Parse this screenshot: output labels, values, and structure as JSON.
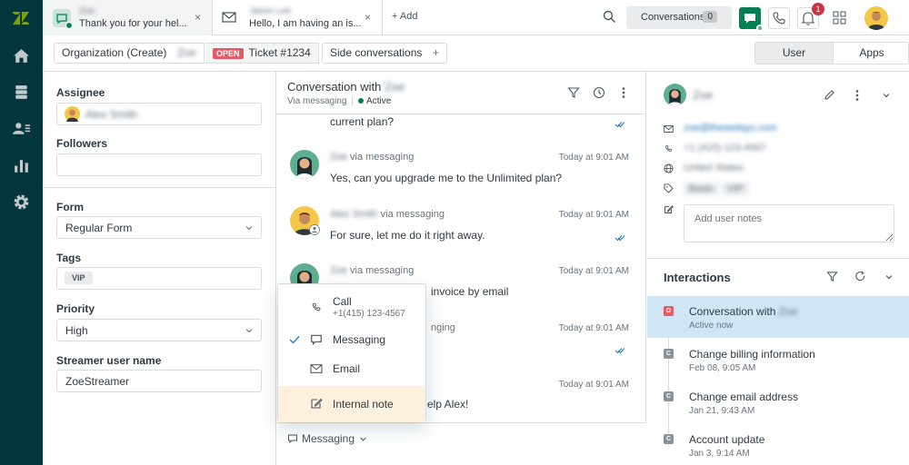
{
  "top_tabs": [
    {
      "name": "Zoe",
      "preview": "Thank you for your hel...",
      "close": "×"
    },
    {
      "name": "Jason Lee",
      "preview": "Hello, I am having an is...",
      "close": "×"
    }
  ],
  "add_tab": "+ Add",
  "conversations": {
    "label": "Conversations",
    "count": "0"
  },
  "notifications_count": "1",
  "breadcrumbs": {
    "org": "Organization (Create)",
    "user": "Zoe",
    "status": "OPEN",
    "ticket": "Ticket #1234",
    "side": "Side conversations",
    "plus": "+"
  },
  "context_tabs": {
    "user": "User",
    "apps": "Apps"
  },
  "props": {
    "assignee_label": "Assignee",
    "assignee_value": "Alex Smith",
    "followers_label": "Followers",
    "form_label": "Form",
    "form_value": "Regular Form",
    "tags_label": "Tags",
    "tag_value": "VIP",
    "priority_label": "Priority",
    "priority_value": "High",
    "streamer_label": "Streamer user name",
    "streamer_value": "ZoeStreamer"
  },
  "conversation": {
    "title": "Conversation with",
    "title_name": "Zoe",
    "via": "Via messaging",
    "status": "Active",
    "partial_text": "current plan?",
    "messages": [
      {
        "sender": "Zoe",
        "via": "via messaging",
        "time": "Today at 9:01 AM",
        "text": "Yes, can you upgrade me to the Unlimited plan?"
      },
      {
        "sender": "Alex Smith",
        "via": "via messaging",
        "time": "Today at 9:01 AM",
        "text": "For sure, let me do it right away."
      },
      {
        "sender": "Zoe",
        "via": "via messaging",
        "time": "Today at 9:01 AM",
        "text": "invoice by email"
      },
      {
        "sender": "",
        "via": "nging",
        "time": "Today at 9:01 AM",
        "text": ""
      },
      {
        "sender": "",
        "via": "",
        "time": "Today at 9:01 AM",
        "text": "elp Alex!"
      }
    ],
    "composer_channel": "Messaging"
  },
  "channel_menu": {
    "call_label": "Call",
    "call_number": "+1(415) 123-4567",
    "messaging_label": "Messaging",
    "email_label": "Email",
    "note_label": "Internal note"
  },
  "user_panel": {
    "name": "Zoe",
    "email": "zoe@thesedays.com",
    "phone": "+1 (415) 123-4567",
    "location": "United States",
    "tags": [
      "Basic",
      "VIP"
    ],
    "notes_placeholder": "Add user notes"
  },
  "interactions": {
    "title": "Interactions",
    "items": [
      {
        "badge": "O",
        "title": "Conversation with",
        "name": "Zoe",
        "sub": "Active now"
      },
      {
        "badge": "C",
        "title": "Change billing information",
        "sub": "Feb 08, 9:05 AM"
      },
      {
        "badge": "C",
        "title": "Change email address",
        "sub": "Jan 21, 9:43 AM"
      },
      {
        "badge": "C",
        "title": "Account update",
        "sub": "Jan 3, 9:14 AM"
      }
    ]
  },
  "colors": {
    "nav": "#03363d",
    "accent_green": "#037f52",
    "open_badge": "#e35b66",
    "selected_interaction": "#cfe6f5",
    "note_highlight": "#fdf0dd"
  }
}
